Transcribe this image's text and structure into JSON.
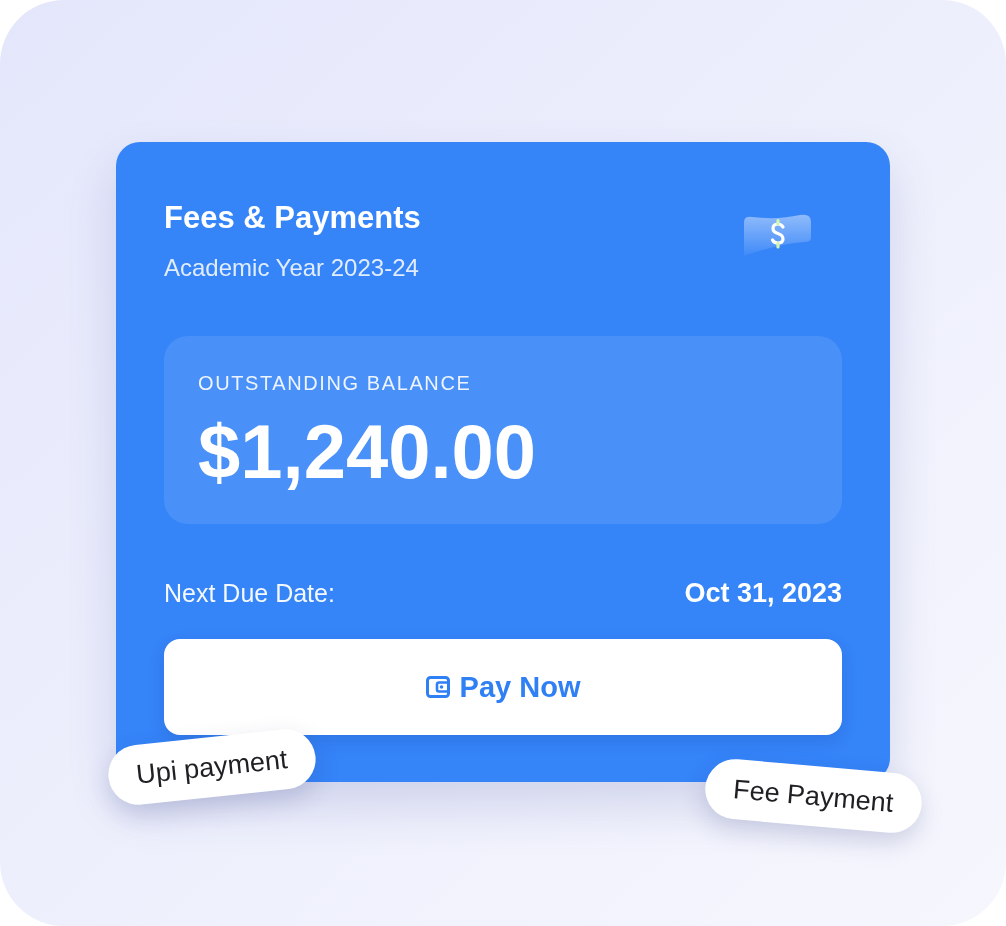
{
  "card": {
    "title": "Fees & Payments",
    "subtitle": "Academic Year 2023-24"
  },
  "balance": {
    "label": "OUTSTANDING BALANCE",
    "amount": "$1,240.00"
  },
  "due": {
    "label": "Next Due Date:",
    "date": "Oct 31, 2023"
  },
  "button": {
    "label": "Pay Now"
  },
  "tags": [
    "Upi payment",
    "Fee Payment"
  ]
}
